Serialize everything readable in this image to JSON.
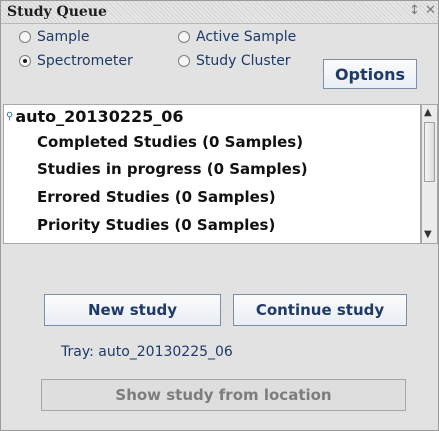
{
  "panel": {
    "title": "Study Queue",
    "pin_icon": "pin-icon",
    "close_icon": "close-icon"
  },
  "view_options": [
    {
      "label": "Sample",
      "checked": false
    },
    {
      "label": "Active Sample",
      "checked": false
    },
    {
      "label": "Spectrometer",
      "checked": true
    },
    {
      "label": "Study Cluster",
      "checked": false
    }
  ],
  "options_button": "Options",
  "tree": {
    "root": "auto_20130225_06",
    "items": [
      "Completed Studies (0 Samples)",
      "Studies in progress (0 Samples)",
      "Errored Studies (0 Samples)",
      "Priority Studies (0 Samples)"
    ]
  },
  "actions": {
    "new_study": "New study",
    "continue_study": "Continue study",
    "tray_label": "Tray: auto_20130225_06",
    "show_study": "Show study from location"
  }
}
